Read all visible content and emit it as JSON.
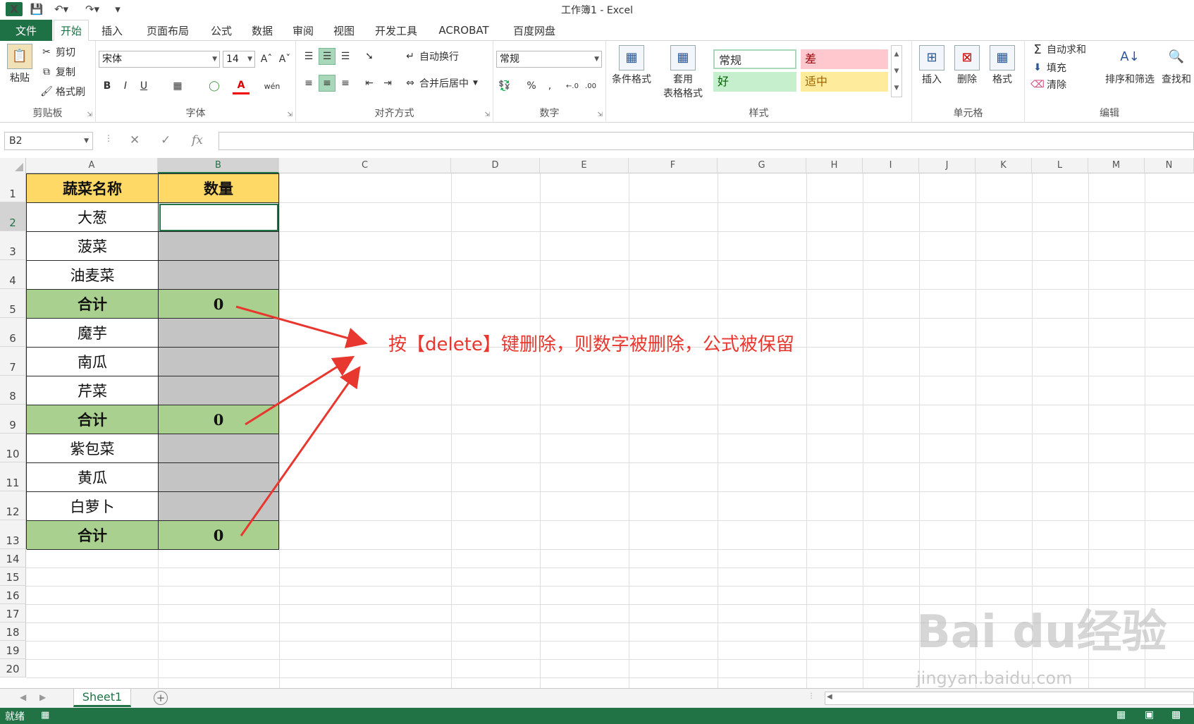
{
  "titlebar": {
    "app_icon": "X",
    "title": "工作簿1 - Excel"
  },
  "tabs": {
    "file": "文件",
    "items": [
      "开始",
      "插入",
      "页面布局",
      "公式",
      "数据",
      "审阅",
      "视图",
      "开发工具",
      "ACROBAT",
      "百度网盘"
    ],
    "active": "开始"
  },
  "ribbon": {
    "clipboard": {
      "label": "剪贴板",
      "paste": "粘贴",
      "cut": "剪切",
      "copy": "复制",
      "format_painter": "格式刷"
    },
    "font": {
      "label": "字体",
      "name": "宋体",
      "size": "14",
      "bold": "B",
      "italic": "I",
      "underline": "U",
      "phonetic": "wén"
    },
    "alignment": {
      "label": "对齐方式",
      "wrap": "自动换行",
      "merge": "合并后居中"
    },
    "number": {
      "label": "数字",
      "format": "常规",
      "percent": "%",
      "comma": ","
    },
    "styles": {
      "label": "样式",
      "conditional": "条件格式",
      "table_line1": "套用",
      "table_line2": "表格格式",
      "normal": "常规",
      "bad": "差",
      "good": "好",
      "neutral": "适中"
    },
    "cells": {
      "label": "单元格",
      "insert": "插入",
      "delete": "删除",
      "format": "格式"
    },
    "editing": {
      "label": "编辑",
      "autosum": "自动求和",
      "fill": "填充",
      "clear": "清除",
      "sort": "排序和筛选",
      "find": "查找和"
    }
  },
  "formula_bar": {
    "name_box": "B2",
    "fx": "fx",
    "value": ""
  },
  "sheet": {
    "columns": [
      "A",
      "B",
      "C",
      "D",
      "E",
      "F",
      "G",
      "H",
      "I",
      "J",
      "K",
      "L",
      "M",
      "N"
    ],
    "rows": [
      "1",
      "2",
      "3",
      "4",
      "5",
      "6",
      "7",
      "8",
      "9",
      "10",
      "11",
      "12",
      "13",
      "14",
      "15",
      "16",
      "17",
      "18",
      "19",
      "20"
    ],
    "header": {
      "name": "蔬菜名称",
      "qty": "数量"
    },
    "cells": {
      "A2": "大葱",
      "A3": "菠菜",
      "A4": "油麦菜",
      "A5": "合计",
      "B5": "0",
      "A6": "魔芋",
      "A7": "南瓜",
      "A8": "芹菜",
      "A9": "合计",
      "B9": "0",
      "A10": "紫包菜",
      "A11": "黄瓜",
      "A12": "白萝卜",
      "A13": "合计",
      "B13": "0"
    },
    "selected_cell": "B2",
    "annotation": "按【delete】键删除，则数字被删除，公式被保留"
  },
  "sheet_tabs": {
    "active": "Sheet1",
    "add": "+"
  },
  "status": {
    "text": "就绪"
  },
  "watermark": {
    "logo": "Bai du经验",
    "url": "jingyan.baidu.com"
  },
  "colors": {
    "excel_green": "#217346",
    "header_yellow": "#ffd966",
    "total_green": "#a9d08e",
    "input_gray": "#c4c4c4",
    "annotation_red": "#e8372f"
  }
}
